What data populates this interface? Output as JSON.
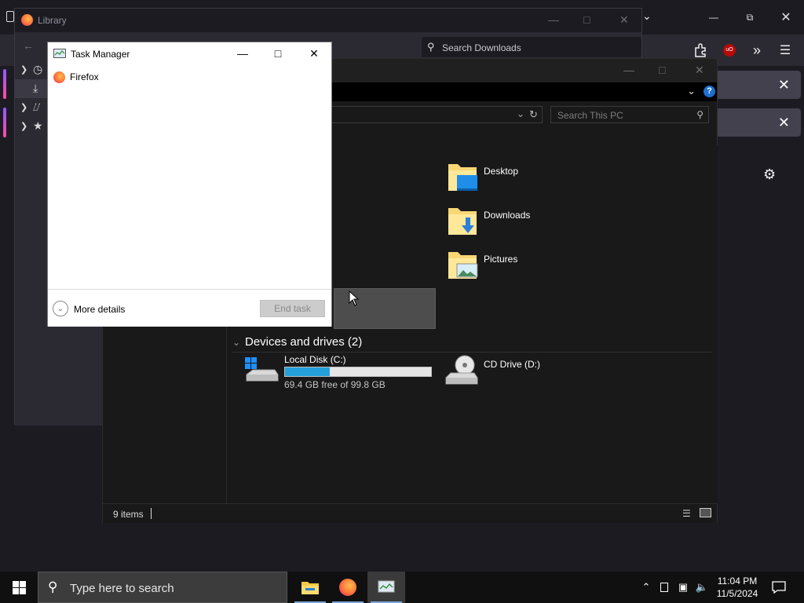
{
  "library": {
    "title": "Library",
    "search_placeholder": "Search Downloads"
  },
  "explorer": {
    "search_placeholder": "Search This PC",
    "folders": [
      {
        "label": "Desktop",
        "icon": "desktop-folder-icon"
      },
      {
        "label": "Downloads",
        "icon": "downloads-folder-icon"
      },
      {
        "label": "Pictures",
        "icon": "pictures-folder-icon"
      }
    ],
    "devices_header": "Devices and drives (2)",
    "local_disk": {
      "label": "Local Disk (C:)",
      "free_text": "69.4 GB free of 99.8 GB",
      "used_fraction": 0.305
    },
    "cd_drive": {
      "label": "CD Drive (D:)"
    },
    "status": "9 items"
  },
  "taskmgr": {
    "title": "Task Manager",
    "apps": [
      "Firefox"
    ],
    "more_details": "More details",
    "end_task": "End task"
  },
  "taskbar": {
    "search_placeholder": "Type here to search",
    "time": "11:04 PM",
    "date": "11/5/2024"
  },
  "colors": {
    "accent": "#26a0da",
    "folder_yellow": "#f8d775",
    "taskbar_bg": "#101010",
    "firefox_notif": "#42414d"
  }
}
